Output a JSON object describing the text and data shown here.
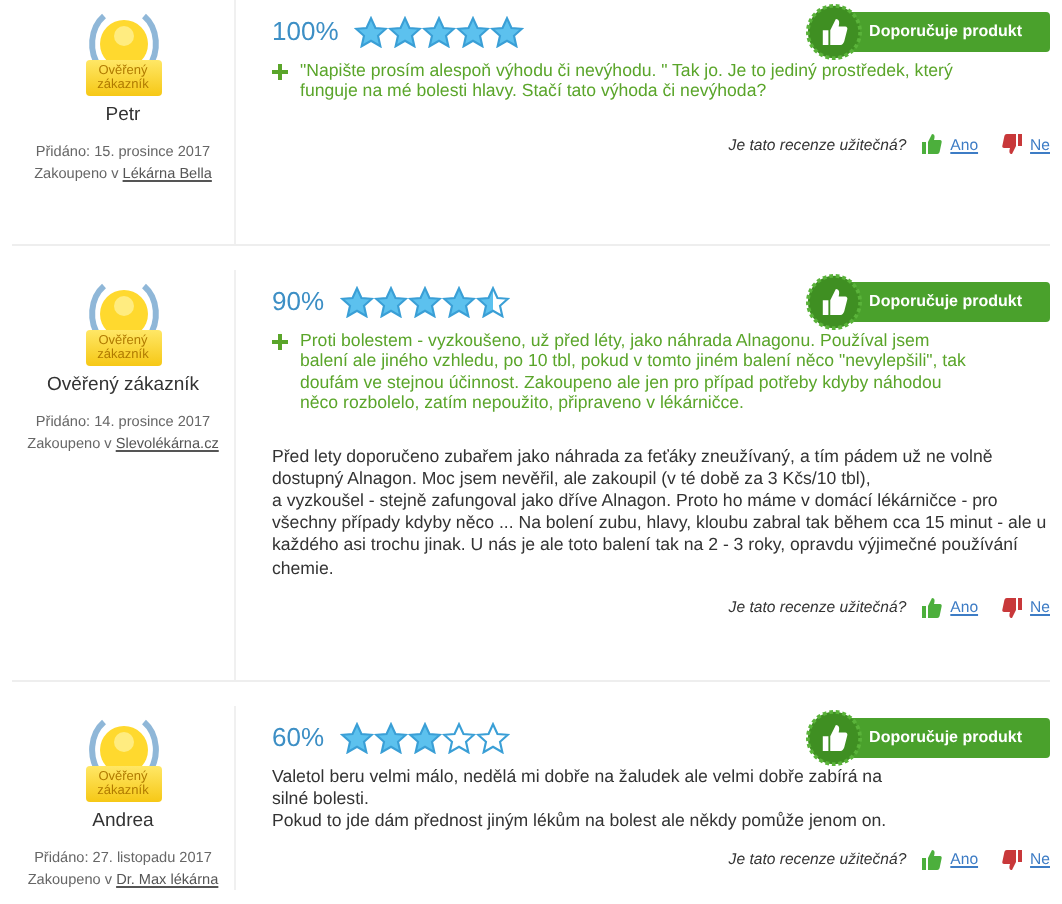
{
  "reviews": [
    {
      "badge": "Ověřený zákazník",
      "name": "Petr",
      "added": "Přidáno: 15. prosince 2017",
      "bought_prefix": "Zakoupeno v",
      "shop": "Lékárna Bella",
      "rating": "100%",
      "stars": 5,
      "recommend": "Doporučuje produkt",
      "pros": "\"Napište prosím alespoň výhodu či nevýhodu. \" Tak jo. Je to jediný prostředek, který funguje na mé bolesti hlavy. Stačí tato výhoda či nevýhoda?",
      "helpful": "Je tato recenze užitečná?",
      "yes": "Ano",
      "no": "Ne"
    },
    {
      "badge": "Ověřený zákazník",
      "name": "Ověřený zákazník",
      "added": "Přidáno: 14. prosince 2017",
      "bought_prefix": "Zakoupeno v",
      "shop": "Slevolékárna.cz",
      "rating": "90%",
      "stars": 4.5,
      "recommend": "Doporučuje produkt",
      "pros": "Proti bolestem - vyzkoušeno, už před léty, jako náhrada Alnagonu. Používal jsem balení ale jiného vzhledu, po 10 tbl, pokud v tomto jiném balení něco \"nevylepšili\", tak doufám ve stejnou účinnost. Zakoupeno ale jen pro případ potřeby kdyby náhodou něco rozbolelo, zatím nepoužito, připraveno v lékárničce.",
      "body": [
        "Před lety doporučeno zubařem jako náhrada za feťáky zneužívaný, a tím pádem už ne volně dostupný Alnagon. Moc jsem nevěřil, ale zakoupil (v té době za 3 Kčs/10 tbl),",
        "a vyzkoušel - stejně zafungoval jako dříve Alnagon. Proto ho máme v domácí lékárničce - pro všechny případy kdyby něco ... Na bolení zubu, hlavy, kloubu zabral tak během cca 15 minut - ale u každého asi trochu jinak. U nás je ale toto balení tak na 2 - 3 roky, opravdu výjimečné používání chemie."
      ],
      "helpful": "Je tato recenze užitečná?",
      "yes": "Ano",
      "no": "Ne"
    },
    {
      "badge": "Ověřený zákazník",
      "name": "Andrea",
      "added": "Přidáno: 27. listopadu 2017",
      "bought_prefix": "Zakoupeno v",
      "shop": "Dr. Max lékárna",
      "rating": "60%",
      "stars": 3,
      "recommend": "Doporučuje produkt",
      "body": [
        "Valetol beru velmi málo, nedělá mi dobře na žaludek ale velmi dobře zabírá na silné bolesti.",
        "Pokud to jde dám přednost jiným lékům na bolest ale někdy pomůže jenom on."
      ],
      "helpful": "Je tato recenze užitečná?",
      "yes": "Ano",
      "no": "Ne"
    }
  ]
}
